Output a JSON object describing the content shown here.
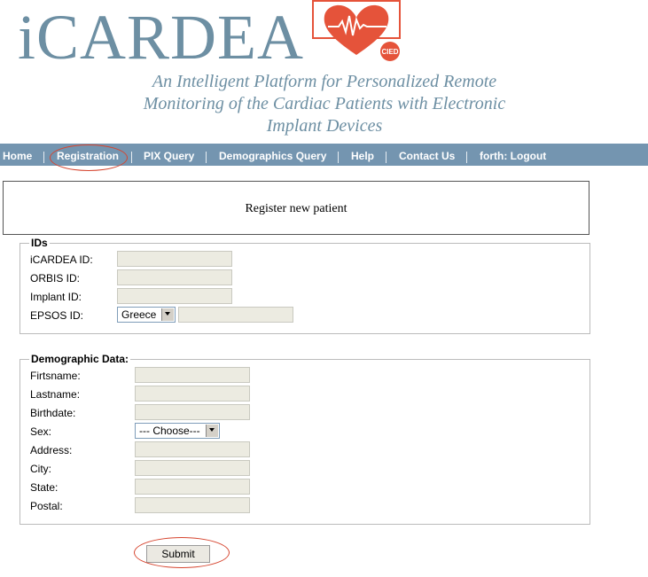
{
  "header": {
    "logo_text": "iCARDEA",
    "logo_badge": "CIED",
    "tagline_lines": [
      "An Intelligent Platform for Personalized Remote",
      "Monitoring of the Cardiac Patients with Electronic",
      "Implant Devices"
    ],
    "colors": {
      "logo": "#6d8fa3",
      "heart": "#e5533a"
    }
  },
  "nav": {
    "items": [
      {
        "label": "Home"
      },
      {
        "label": "Registration"
      },
      {
        "label": "PIX Query"
      },
      {
        "label": "Demographics Query"
      },
      {
        "label": "Help"
      },
      {
        "label": "Contact Us"
      },
      {
        "label": "forth: Logout"
      }
    ],
    "active": "Registration",
    "color": "#7495b0"
  },
  "page_title": "Register new patient",
  "ids_section": {
    "legend": "IDs",
    "fields": [
      {
        "label": "iCARDEA ID:",
        "value": ""
      },
      {
        "label": "ORBIS ID:",
        "value": ""
      },
      {
        "label": "Implant ID:",
        "value": ""
      },
      {
        "label": "EPSOS ID:",
        "value": ""
      }
    ],
    "epsos_country": "Greece"
  },
  "demo_section": {
    "legend": "Demographic Data:",
    "fields": [
      {
        "label": "Firtsname:",
        "value": ""
      },
      {
        "label": "Lastname:",
        "value": ""
      },
      {
        "label": "Birthdate:",
        "value": ""
      },
      {
        "label": "Sex:",
        "value": ""
      },
      {
        "label": "Address:",
        "value": ""
      },
      {
        "label": "City:",
        "value": ""
      },
      {
        "label": "State:",
        "value": ""
      },
      {
        "label": "Postal:",
        "value": ""
      }
    ],
    "sex_selected": "--- Choose---"
  },
  "submit_label": "Submit"
}
